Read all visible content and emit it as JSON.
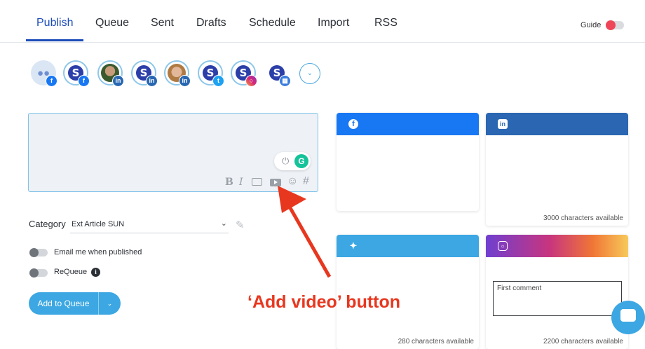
{
  "nav": {
    "tabs": [
      "Publish",
      "Queue",
      "Sent",
      "Drafts",
      "Schedule",
      "Import",
      "RSS"
    ],
    "active_tab": "Publish",
    "guide_label": "Guide"
  },
  "accounts": [
    {
      "type": "group",
      "network": "facebook"
    },
    {
      "type": "brand",
      "network": "facebook"
    },
    {
      "type": "photo",
      "network": "linkedin"
    },
    {
      "type": "brand",
      "network": "linkedin"
    },
    {
      "type": "photo",
      "network": "linkedin"
    },
    {
      "type": "brand",
      "network": "twitter"
    },
    {
      "type": "brand",
      "network": "instagram"
    },
    {
      "type": "brand",
      "network": "google-business"
    }
  ],
  "composer": {
    "text": "",
    "tools": [
      "B",
      "I",
      "image-icon",
      "video-icon",
      "emoji-icon",
      "#"
    ]
  },
  "category": {
    "label": "Category",
    "value": "Ext Article SUN"
  },
  "options": {
    "email_label": "Email me when published",
    "requeue_label": "ReQueue"
  },
  "actions": {
    "add_to_queue_label": "Add to Queue"
  },
  "previews": {
    "facebook": {
      "color": "#1877f2",
      "note": ""
    },
    "linkedin": {
      "color": "#2a66b1",
      "note": "3000 characters available"
    },
    "twitter": {
      "color": "#3ca7e2",
      "note": "280 characters available"
    },
    "instagram": {
      "note": "2200 characters available",
      "first_comment_label": "First comment"
    }
  },
  "annotation": {
    "text": "‘Add video’ button",
    "color": "#e8371f"
  }
}
